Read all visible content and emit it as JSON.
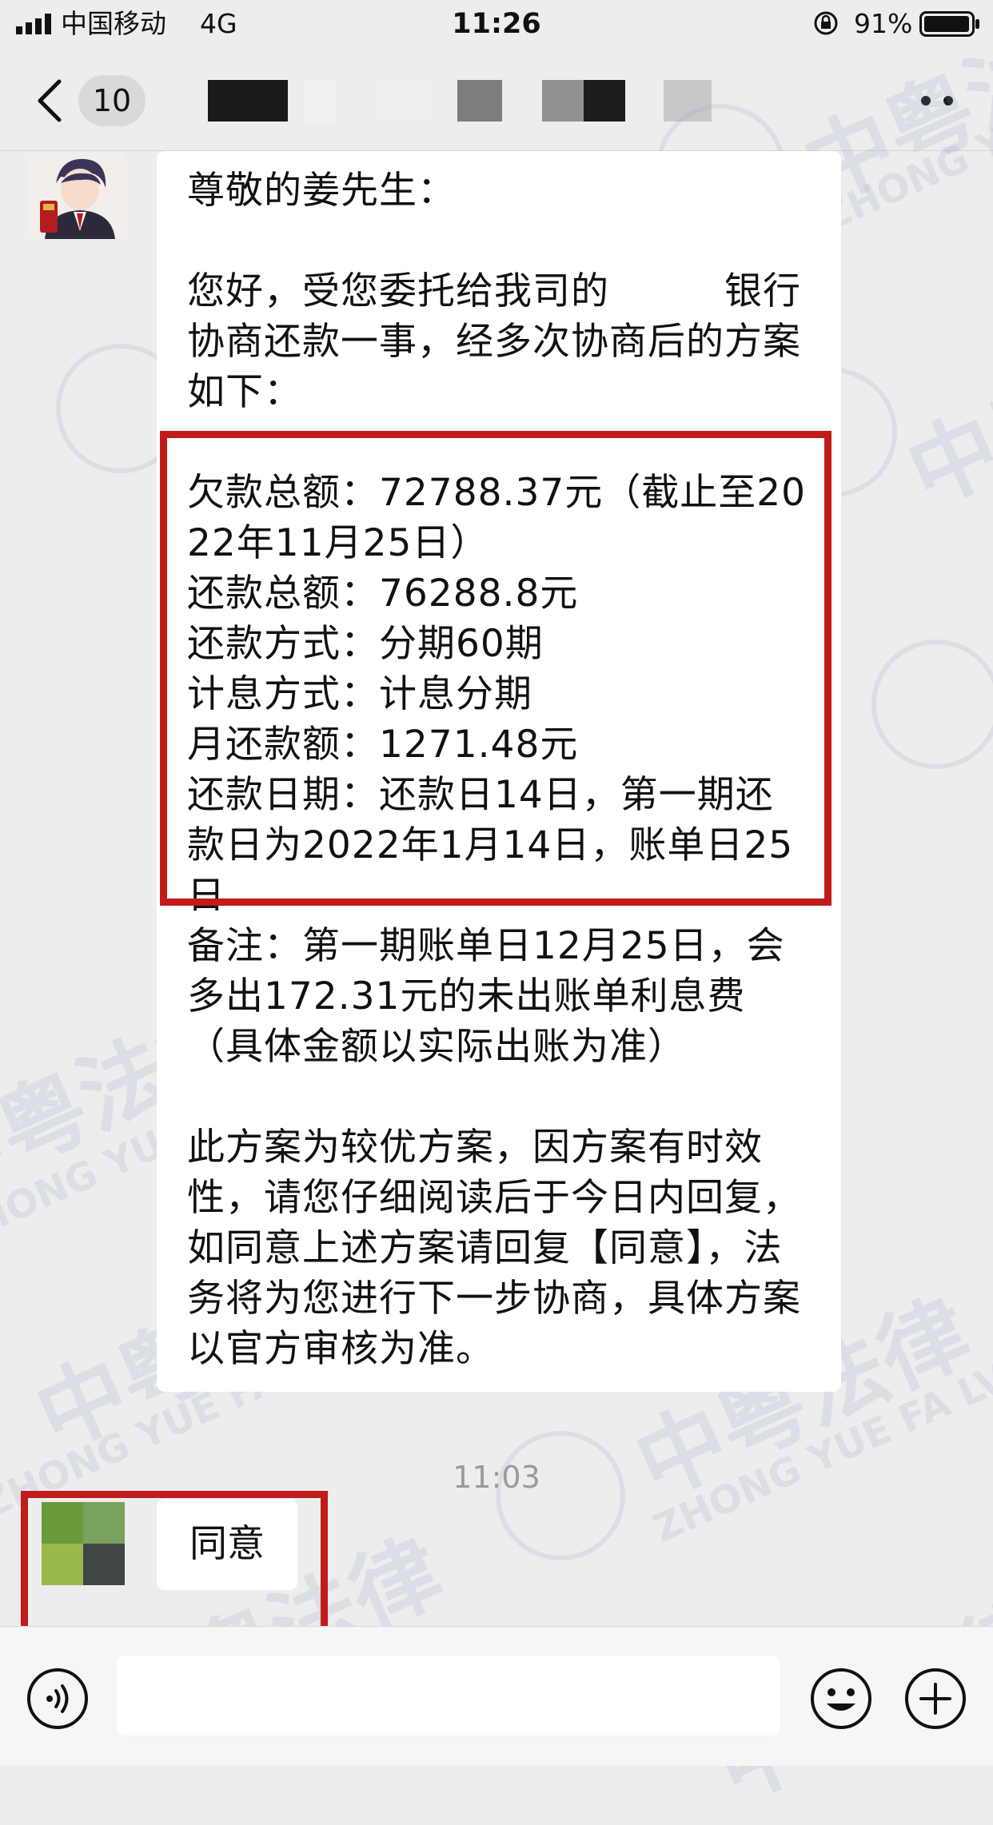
{
  "status_bar": {
    "carrier": "中国移动",
    "network": "4G",
    "time": "11:26",
    "battery": "91%"
  },
  "nav": {
    "unread_count": "10"
  },
  "messages": {
    "agent": {
      "greeting": "尊敬的姜先生：",
      "intro": "您好，受您委托给我司的　　　银行协商还款一事，经多次协商后的方案如下：",
      "plan": [
        "欠款总额：72788.37元（截止至2022年11月25日）",
        "还款总额：76288.8元",
        "还款方式：分期60期",
        "计息方式：计息分期",
        "月还款额：1271.48元",
        "还款日期：还款日14日，第一期还款日为2022年1月14日，账单日25日"
      ],
      "note": "备注：第一期账单日12月25日，会多出172.31元的未出账单利息费（具体金额以实际出账为准）",
      "closing": "此方案为较优方案，因方案有时效性，请您仔细阅读后于今日内回复，如同意上述方案请回复【同意】，法务将为您进行下一步协商，具体方案以官方审核为准。"
    },
    "timestamp": "11:03",
    "user_reply": "同意"
  },
  "watermark": {
    "cn": "中粤法律",
    "en": "ZHONG YUE FA LV"
  },
  "colors": {
    "highlight": "#c21b1b",
    "background": "#ededed",
    "bubble": "#ffffff"
  },
  "icons": [
    "signal-icon",
    "lock-rotation-icon",
    "battery-icon",
    "back-chevron-icon",
    "more-icon",
    "voice-icon",
    "emoji-icon",
    "plus-icon"
  ]
}
